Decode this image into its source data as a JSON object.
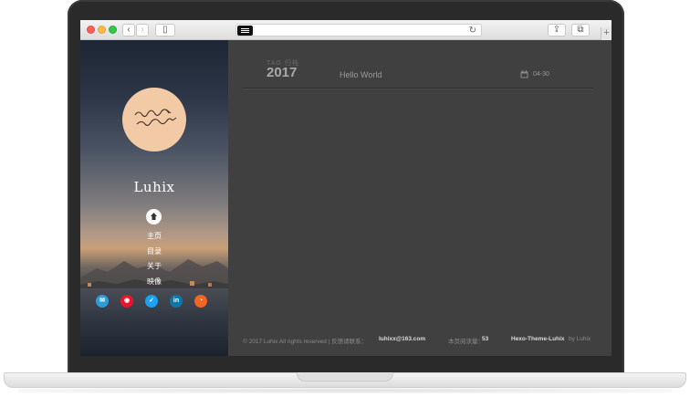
{
  "browser": {
    "back_glyph": "‹",
    "forward_glyph": "›",
    "reload_glyph": "↻",
    "share_glyph": "⇪",
    "tabs_glyph": "⧉",
    "newtab_glyph": "+",
    "sidebar_glyph": "▯"
  },
  "sidebar": {
    "site_name": "Luhix",
    "home_icon": "home-icon",
    "nav": [
      {
        "label": "主页"
      },
      {
        "label": "目录"
      },
      {
        "label": "关于"
      },
      {
        "label": "映像"
      }
    ],
    "social": [
      {
        "icon": "mail-icon",
        "color": "#2d9cdb",
        "glyph": "✉"
      },
      {
        "icon": "weibo-icon",
        "color": "#e6162d",
        "glyph": "◉"
      },
      {
        "icon": "twitter-icon",
        "color": "#1da1f2",
        "glyph": "✓"
      },
      {
        "icon": "linkedin-icon",
        "color": "#0e76a8",
        "glyph": "in"
      },
      {
        "icon": "rss-icon",
        "color": "#f26522",
        "glyph": "◔"
      }
    ]
  },
  "main": {
    "year_label": "TAG 归档",
    "year": "2017",
    "post_title": "Hello World",
    "post_date": "04-30"
  },
  "footer": {
    "copyright": "© 2017 Luhix All rights reserved | 反馈请联系：",
    "email": "luhixx@163.com",
    "visits_label": "本页阅读量：",
    "visits": "53",
    "theme": "Hexo-Theme-Luhix",
    "by": " by Luhix"
  },
  "colors": {
    "main_bg": "#404040",
    "avatar_bg": "#f2cba6"
  }
}
